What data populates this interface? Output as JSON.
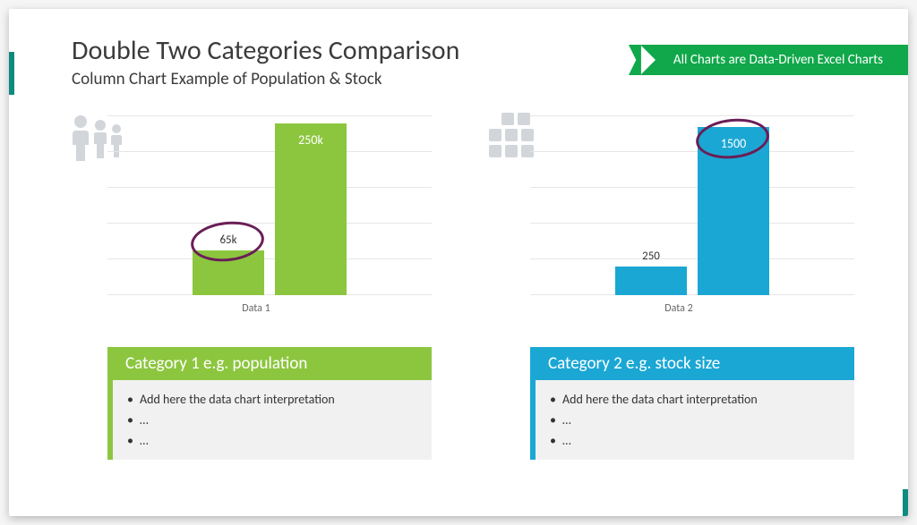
{
  "header": {
    "title": "Double Two Categories Comparison",
    "subtitle": "Column Chart Example of Population & Stock"
  },
  "badge": "All Charts are Data-Driven Excel Charts",
  "columns": [
    {
      "icon": "people-icon",
      "color": "#8cc63f",
      "accent": "#8cc63f",
      "xlabel": "Data 1",
      "cat_title": "Category 1 e.g. population",
      "bullets": [
        "Add here the data chart interpretation",
        "…",
        "…"
      ],
      "highlight_index": 0
    },
    {
      "icon": "grid-icon",
      "color": "#1ba7d4",
      "accent": "#1ba7d4",
      "xlabel": "Data 2",
      "cat_title": "Category 2 e.g. stock size",
      "bullets": [
        "Add here the data chart interpretation",
        "…",
        "…"
      ],
      "highlight_index": 1
    }
  ],
  "chart_data": [
    {
      "type": "bar",
      "categories": [
        "",
        ""
      ],
      "values": [
        65,
        250
      ],
      "value_labels": [
        "65k",
        "250k"
      ],
      "title": "",
      "xlabel": "Data 1",
      "ylabel": "",
      "ylim": [
        0,
        260
      ],
      "color": "#8cc63f"
    },
    {
      "type": "bar",
      "categories": [
        "",
        ""
      ],
      "values": [
        250,
        1500
      ],
      "value_labels": [
        "250",
        "1500"
      ],
      "title": "",
      "xlabel": "Data 2",
      "ylabel": "",
      "ylim": [
        0,
        1600
      ],
      "color": "#1ba7d4"
    }
  ]
}
